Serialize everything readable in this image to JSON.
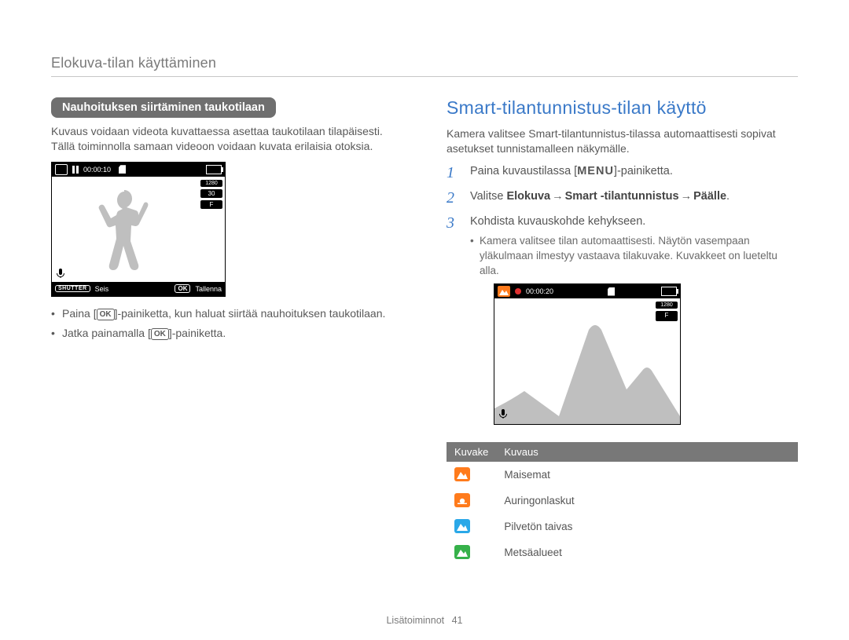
{
  "running_head": "Elokuva-tilan käyttäminen",
  "left": {
    "pill": "Nauhoituksen siirtäminen taukotilaan",
    "para": "Kuvaus voidaan videota kuvattaessa asettaa taukotilaan tilapäisesti. Tällä toiminnolla samaan videoon voidaan kuvata erilaisia otoksia.",
    "cam": {
      "time": "00:00:10",
      "res": "1280",
      "fps": "30",
      "af": "F",
      "shutter_label": "SHUTTER",
      "shutter_text": "Seis",
      "ok_label": "OK",
      "ok_text": "Tallenna"
    },
    "bullet1_a": "Paina [",
    "bullet1_b": "]-painiketta, kun haluat siirtää nauhoituksen taukotilaan.",
    "bullet2_a": "Jatka painamalla [",
    "bullet2_b": "]-painiketta.",
    "ok_inline": "OK"
  },
  "right": {
    "title": "Smart-tilantunnistus-tilan käyttö",
    "intro": "Kamera valitsee Smart-tilantunnistus-tilassa automaattisesti sopivat asetukset tunnistamalleen näkymälle.",
    "steps": {
      "s1_a": "Paina kuvaustilassa [",
      "s1_menu": "MENU",
      "s1_b": "]-painiketta.",
      "s2_a": "Valitse ",
      "s2_b1": "Elokuva",
      "s2_b2": "Smart -tilantunnistus",
      "s2_b3": "Päälle",
      "s3": "Kohdista kuvauskohde kehykseen.",
      "s3_sub": "Kamera valitsee tilan automaattisesti. Näytön vasempaan yläkulmaan ilmestyy vastaava tilakuvake. Kuvakkeet on lueteltu alla."
    },
    "cam": {
      "time": "00:00:20",
      "res": "1280",
      "af": "F"
    },
    "table": {
      "h1": "Kuvake",
      "h2": "Kuvaus",
      "rows": [
        {
          "label": "Maisemat",
          "color": "c-orange",
          "icon": "mountain"
        },
        {
          "label": "Auringonlaskut",
          "color": "c-sunset",
          "icon": "sunset"
        },
        {
          "label": "Pilvetön taivas",
          "color": "c-sky",
          "icon": "mountain"
        },
        {
          "label": "Metsäalueet",
          "color": "c-forest",
          "icon": "mountain"
        }
      ]
    }
  },
  "footer": {
    "section": "Lisätoiminnot",
    "page": "41"
  }
}
